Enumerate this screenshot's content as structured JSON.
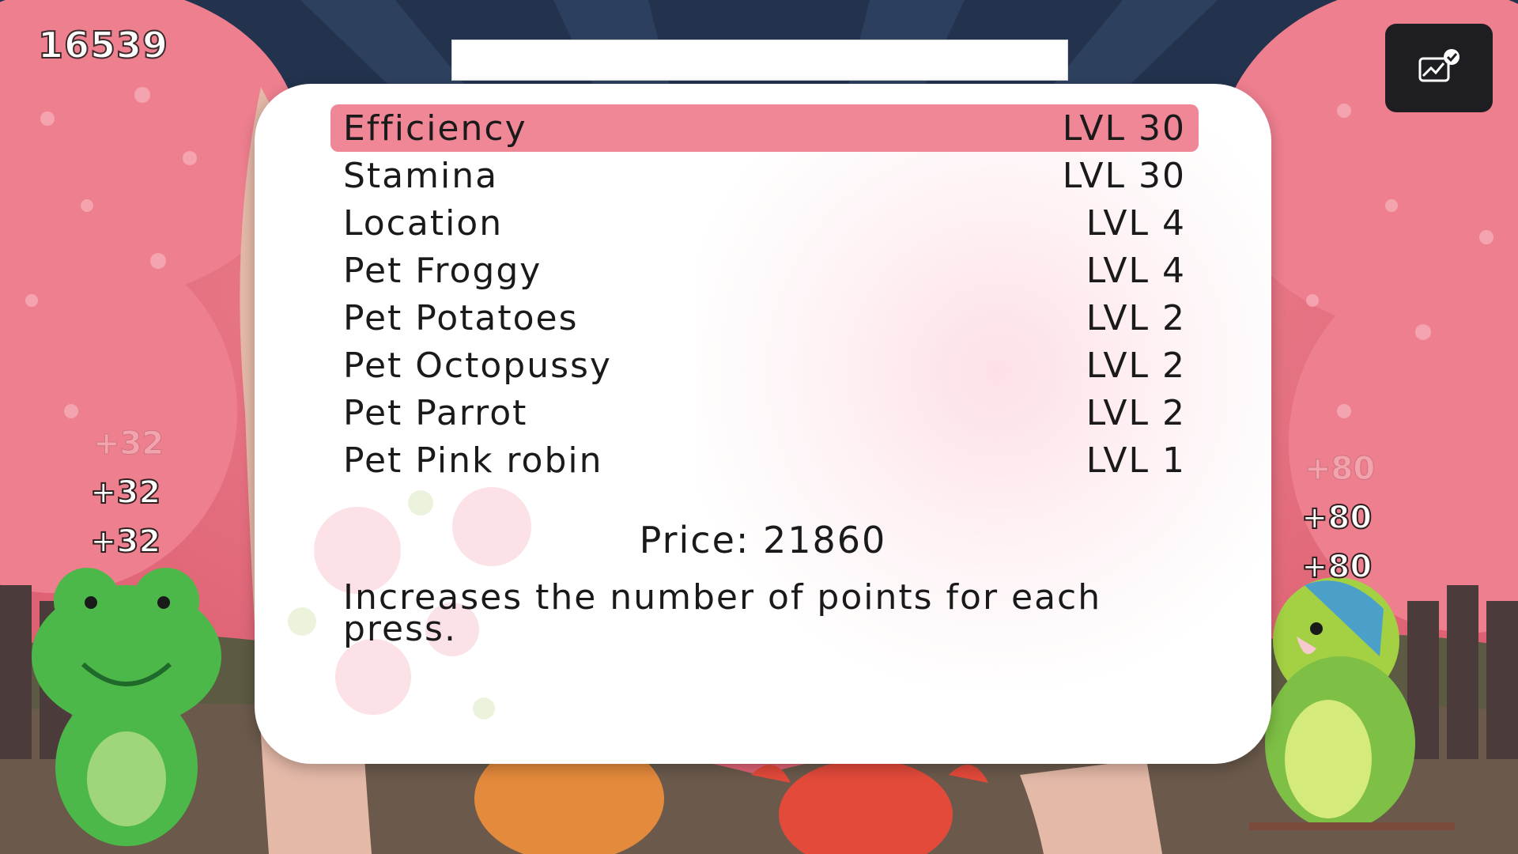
{
  "hud": {
    "score": "16539",
    "corner_icon": "stats-check-icon"
  },
  "popups": {
    "left": [
      "+32",
      "+32",
      "+32"
    ],
    "right": [
      "+80",
      "+80",
      "+80"
    ]
  },
  "upgrades": [
    {
      "name": "Efficiency",
      "level": "LVL 30",
      "selected": true
    },
    {
      "name": "Stamina",
      "level": "LVL 30",
      "selected": false
    },
    {
      "name": "Location",
      "level": "LVL 4",
      "selected": false
    },
    {
      "name": "Pet Froggy",
      "level": "LVL 4",
      "selected": false
    },
    {
      "name": "Pet Potatoes",
      "level": "LVL 2",
      "selected": false
    },
    {
      "name": "Pet Octopussy",
      "level": "LVL 2",
      "selected": false
    },
    {
      "name": "Pet Parrot",
      "level": "LVL 2",
      "selected": false
    },
    {
      "name": "Pet Pink robin",
      "level": "LVL 1",
      "selected": false
    }
  ],
  "details": {
    "price": "Price: 21860",
    "description": "Increases the number of points for each press."
  },
  "colors": {
    "selected_row": "#ef8797",
    "background_pink": "#e86a7c",
    "sky_navy": "#23324d"
  }
}
